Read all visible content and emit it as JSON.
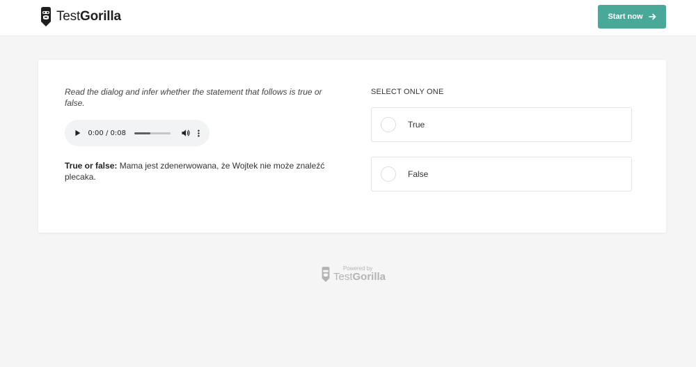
{
  "header": {
    "brand_light": "Test",
    "brand_bold": "Gorilla",
    "start_label": "Start now"
  },
  "question": {
    "instruction": "Read the dialog and infer whether the statement that follows is true or false.",
    "audio": {
      "current_time": "0:00",
      "separator": " / ",
      "duration": "0:08",
      "progress": 0.45
    },
    "statement_prefix": "True or false:",
    "statement_text": " Mama jest zdenerwowana, że Wojtek nie może znaleźć plecaka."
  },
  "answers": {
    "select_label": "SELECT ONLY ONE",
    "options": [
      {
        "label": "True"
      },
      {
        "label": "False"
      }
    ]
  },
  "footer": {
    "powered_by": "Powered by",
    "brand_light": "Test",
    "brand_bold": "Gorilla"
  },
  "colors": {
    "accent": "#4aa898",
    "background": "#f5f5f5",
    "card": "#ffffff"
  }
}
